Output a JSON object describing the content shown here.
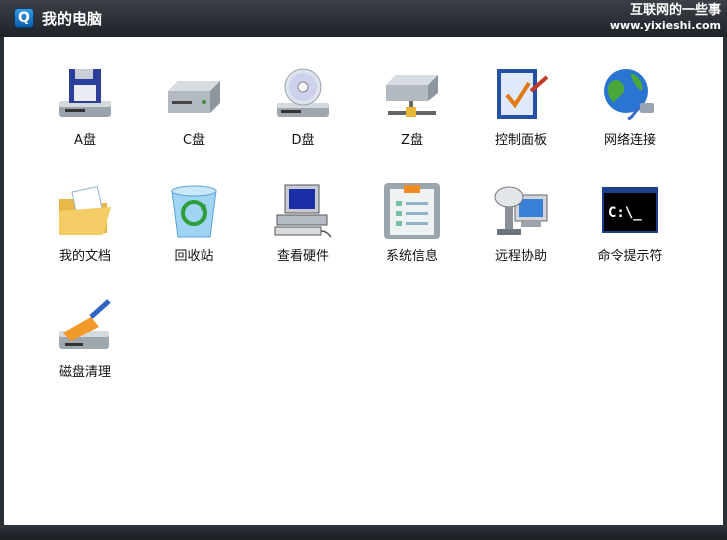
{
  "window": {
    "title": "我的电脑",
    "app_icon_glyph": "Q",
    "watermark_line1": "互联网的一些事",
    "watermark_line2": "www.yixieshi.com"
  },
  "items": [
    {
      "label": "A盘",
      "icon": "floppy-drive-icon"
    },
    {
      "label": "C盘",
      "icon": "hard-drive-icon"
    },
    {
      "label": "D盘",
      "icon": "cd-drive-icon"
    },
    {
      "label": "Z盘",
      "icon": "network-drive-icon"
    },
    {
      "label": "控制面板",
      "icon": "control-panel-icon"
    },
    {
      "label": "网络连接",
      "icon": "network-connection-icon"
    },
    {
      "label": "我的文档",
      "icon": "documents-folder-icon"
    },
    {
      "label": "回收站",
      "icon": "recycle-bin-icon"
    },
    {
      "label": "查看硬件",
      "icon": "computer-hardware-icon"
    },
    {
      "label": "系统信息",
      "icon": "system-info-icon"
    },
    {
      "label": "远程协助",
      "icon": "remote-assistance-icon"
    },
    {
      "label": "命令提示符",
      "icon": "command-prompt-icon"
    },
    {
      "label": "磁盘清理",
      "icon": "disk-cleanup-icon"
    }
  ],
  "cmd_text": "C:\\_"
}
